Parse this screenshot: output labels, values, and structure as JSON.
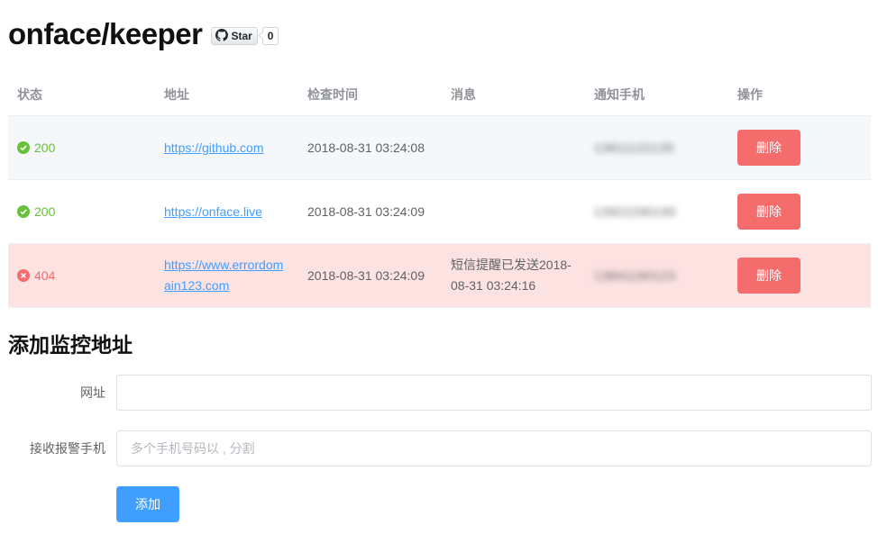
{
  "header": {
    "title": "onface/keeper",
    "github_star_label": "Star",
    "github_star_count": "0"
  },
  "table": {
    "columns": [
      "状态",
      "地址",
      "检查时间",
      "消息",
      "通知手机",
      "操作"
    ],
    "rows": [
      {
        "status_code": "200",
        "status": "ok",
        "url": "https://github.com",
        "check_time": "2018-08-31 03:24:08",
        "message": "",
        "phone": "13811122135",
        "action": "删除"
      },
      {
        "status_code": "200",
        "status": "ok",
        "url": "https://onface.live",
        "check_time": "2018-08-31 03:24:09",
        "message": "",
        "phone": "13922290190",
        "action": "删除"
      },
      {
        "status_code": "404",
        "status": "error",
        "url": "https://www.errordomain123.com",
        "check_time": "2018-08-31 03:24:09",
        "message": "短信提醒已发送2018-08-31 03:24:16",
        "phone": "13841190123",
        "action": "删除"
      }
    ]
  },
  "form": {
    "heading": "添加监控地址",
    "url_label": "网址",
    "url_value": "",
    "url_placeholder": "",
    "phone_label": "接收报警手机",
    "phone_value": "",
    "phone_placeholder": "多个手机号码以 , 分割",
    "submit_label": "添加"
  },
  "colors": {
    "success": "#67c23a",
    "danger": "#f56c6c",
    "primary": "#409eff",
    "error_row_bg": "#fde2e2",
    "hover_row_bg": "#f5f7fa"
  },
  "icons": {
    "ok": "check-circle-icon",
    "error": "close-circle-icon",
    "github": "github-icon"
  }
}
